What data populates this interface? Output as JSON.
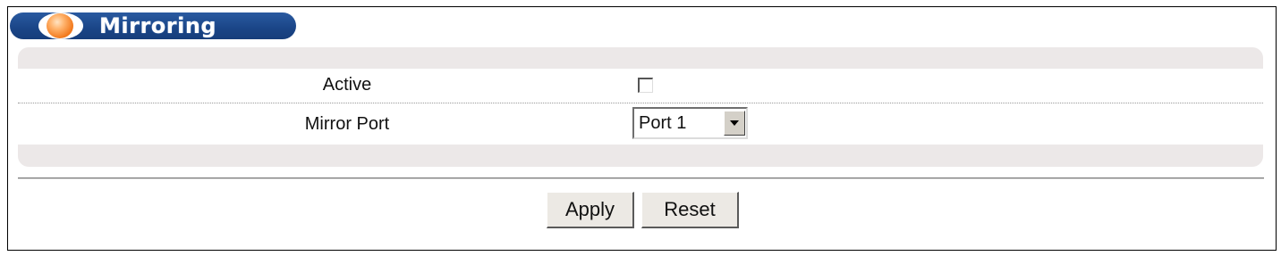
{
  "header": {
    "title": "Mirroring"
  },
  "form": {
    "active": {
      "label": "Active",
      "checked": false
    },
    "mirror_port": {
      "label": "Mirror Port",
      "selected": "Port 1"
    }
  },
  "actions": {
    "apply_label": "Apply",
    "reset_label": "Reset"
  },
  "colors": {
    "title_bar": "#1a4587",
    "title_orb": "#f27a1e",
    "panel_bg": "#ece8e8"
  }
}
